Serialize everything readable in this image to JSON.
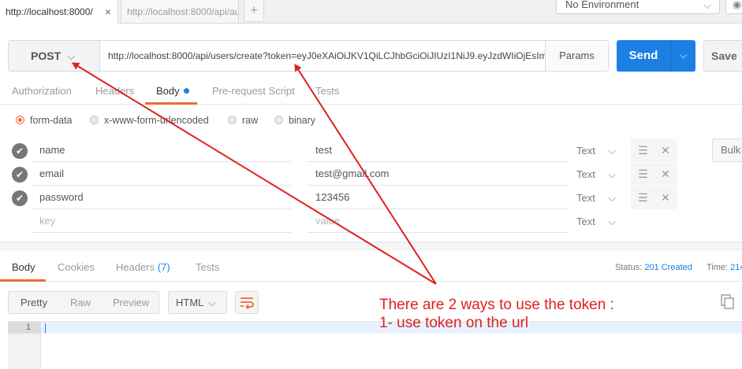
{
  "tabs": [
    {
      "label": "http://localhost:8000/",
      "close": "×"
    },
    {
      "label": "http://localhost:8000/api/au"
    }
  ],
  "new_tab_label": "+",
  "environment": {
    "selected": "No Environment"
  },
  "request": {
    "method": "POST",
    "url": "http://localhost:8000/api/users/create?token=eyJ0eXAiOiJKV1QiLCJhbGciOiJIUzI1NiJ9.eyJzdWIiOjEsIm",
    "params_label": "Params",
    "send_label": "Send",
    "save_label": "Save"
  },
  "request_tabs": [
    {
      "label": "Authorization"
    },
    {
      "label": "Headers"
    },
    {
      "label": "Body"
    },
    {
      "label": "Pre-request Script"
    },
    {
      "label": "Tests"
    }
  ],
  "body_types": [
    {
      "label": "form-data",
      "selected": true
    },
    {
      "label": "x-www-form-urlencoded",
      "selected": false
    },
    {
      "label": "raw",
      "selected": false
    },
    {
      "label": "binary",
      "selected": false
    }
  ],
  "form_rows": [
    {
      "key": "name",
      "value": "test",
      "type": "Text"
    },
    {
      "key": "email",
      "value": "test@gmail.com",
      "type": "Text"
    },
    {
      "key": "password",
      "value": "123456",
      "type": "Text"
    }
  ],
  "new_row": {
    "key_placeholder": "key",
    "value_placeholder": "value",
    "type": "Text"
  },
  "bulk_label": "Bulk",
  "response_tabs": [
    {
      "label": "Body"
    },
    {
      "label": "Cookies"
    },
    {
      "label": "Headers",
      "count": "(7)"
    },
    {
      "label": "Tests"
    }
  ],
  "status": {
    "label": "Status:",
    "value": "201 Created",
    "time_label": "Time:",
    "time_value": "214"
  },
  "format_modes": [
    {
      "label": "Pretty",
      "active": true
    },
    {
      "label": "Raw",
      "active": false
    },
    {
      "label": "Preview",
      "active": false
    }
  ],
  "response_format": "HTML",
  "editor_line": "1",
  "annotation": {
    "line1": "There are 2 ways to use the token :",
    "line2": "1- use token on the url"
  },
  "colors": {
    "accent": "#f06a35",
    "send": "#1c7fe4",
    "annotation": "#e02020",
    "status": "#1c7fe4"
  },
  "icons": [
    "chevron-down-icon",
    "close-icon",
    "check-icon",
    "menu-icon",
    "wrap-lines-icon",
    "copy-icon",
    "eye-icon",
    "dot-icon"
  ]
}
